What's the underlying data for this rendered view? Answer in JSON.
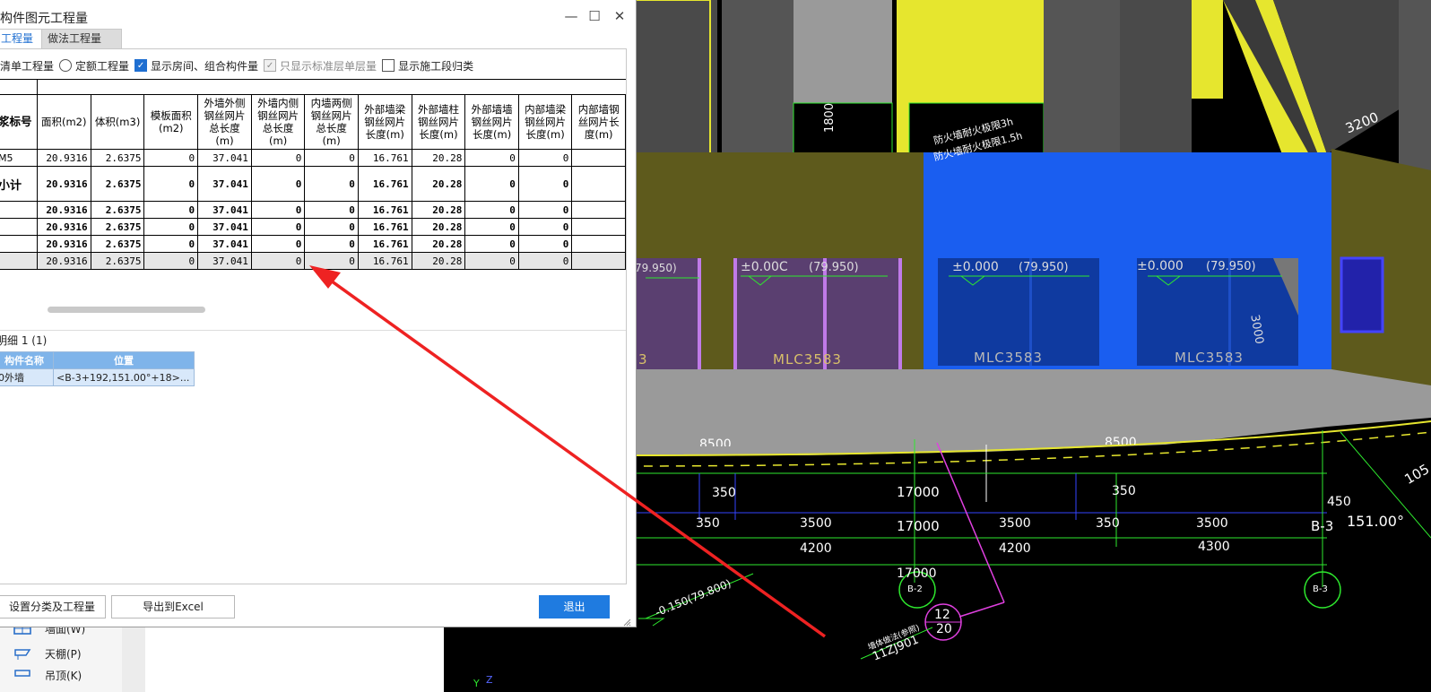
{
  "dialog": {
    "title": "构件图元工程量",
    "tabs": [
      "工程量",
      "做法工程量"
    ],
    "options": {
      "qingdan": "清单工程量",
      "dinge": "定额工程量",
      "show_rooms": "显示房间、组合构件量",
      "only_standard": "只显示标准层单层量",
      "show_stage": "显示施工段归类"
    },
    "table": {
      "first_col_header": "浆标号",
      "headers": [
        "面积(m2)",
        "体积(m3)",
        "模板面积(m2)",
        "外墙外侧钢丝网片总长度(m)",
        "外墙内侧钢丝网片总长度(m)",
        "内墙两侧钢丝网片总长度(m)",
        "外部墙梁钢丝网片长度(m)",
        "外部墙柱钢丝网片长度(m)",
        "外部墙墙钢丝网片长度(m)",
        "内部墙梁钢丝网片长度(m)",
        "内部墙钢丝网片长度(m)"
      ],
      "rows": [
        {
          "label": "M5",
          "cells": [
            "20.9316",
            "2.6375",
            "0",
            "37.041",
            "0",
            "0",
            "16.761",
            "20.28",
            "0",
            "0",
            ""
          ]
        },
        {
          "label": "小计",
          "cells": [
            "20.9316",
            "2.6375",
            "0",
            "37.041",
            "0",
            "0",
            "16.761",
            "20.28",
            "0",
            "0",
            ""
          ]
        },
        {
          "label": "",
          "cells": [
            "20.9316",
            "2.6375",
            "0",
            "37.041",
            "0",
            "0",
            "16.761",
            "20.28",
            "0",
            "0",
            ""
          ]
        },
        {
          "label": "",
          "cells": [
            "20.9316",
            "2.6375",
            "0",
            "37.041",
            "0",
            "0",
            "16.761",
            "20.28",
            "0",
            "0",
            ""
          ]
        },
        {
          "label": "",
          "cells": [
            "20.9316",
            "2.6375",
            "0",
            "37.041",
            "0",
            "0",
            "16.761",
            "20.28",
            "0",
            "0",
            ""
          ]
        },
        {
          "label": "",
          "cells": [
            "20.9316",
            "2.6375",
            "0",
            "37.041",
            "0",
            "0",
            "16.761",
            "20.28",
            "0",
            "0",
            ""
          ]
        }
      ]
    },
    "detail": {
      "header": "明细  1 (1)",
      "columns": [
        "构件名称",
        "位置"
      ],
      "rows": [
        {
          "name": "0外墙",
          "position": "<B-3+192,151.00°+18>..."
        }
      ]
    },
    "buttons": {
      "settings": "设置分类及工程量",
      "export": "导出到Excel",
      "exit": "退出"
    }
  },
  "sidebar": {
    "items": [
      {
        "label": "墙面(W)",
        "icon": "wall-face-icon"
      },
      {
        "label": "天棚(P)",
        "icon": "ceiling-icon"
      },
      {
        "label": "吊顶(K)",
        "icon": "suspended-ceiling-icon"
      }
    ]
  },
  "cad": {
    "labels": {
      "d1800": "1800",
      "d3200": "3200",
      "d3000": "3000",
      "fire_note1": "防火墙耐火极限3h",
      "fire_note2": "防火墙耐火极限1.5h",
      "elev_a": "±0.000",
      "elev_b": "(79.950)",
      "elev_c": "±0.00C",
      "elev_d": "(79.950)",
      "elev_e": "±0.000",
      "elev_f": "(79.950)",
      "elev_g": "±0.000",
      "elev_h": "(79.950)",
      "elev_i": "79.950)",
      "win1": "MLC3583",
      "win2": "MLC3583",
      "win3": "MLC3583",
      "win_partial": "3",
      "dim_8500a": "8500",
      "dim_8500b": "8500",
      "d350a": "350",
      "d17000a": "17000",
      "d350b": "350",
      "d350c": "350",
      "d3500a": "3500",
      "d17000b": "17000",
      "d3500b": "3500",
      "d350d": "350",
      "d3500c": "3500",
      "d4200a": "4200",
      "d4200b": "4200",
      "d4300": "4300",
      "d17000c": "17000",
      "d450": "450",
      "d105": "105",
      "axis_b3": "B-3",
      "angle": "151.00°",
      "bubble_b2": "B-2",
      "bubble_b3": "B-3",
      "elev_bottom": "-0.150(79.800)",
      "detail_num": "12",
      "detail_den": "20",
      "detail_ref": "11ZJ901",
      "detail_note": "墙体做法(参照)",
      "axis_y": "Y",
      "axis_z": "Z",
      "d4300_partial": "4300"
    }
  },
  "colors": {
    "accent": "#1f7be0",
    "tab_active": "#1f6fd1",
    "wall_olive": "#5e5a1c",
    "wall_blue": "#1a5ef0",
    "wall_yellow": "#e6e62e",
    "window_purple": "#5a3f70",
    "dim_green": "#2ee82e",
    "arrow_red": "#ee2222"
  }
}
